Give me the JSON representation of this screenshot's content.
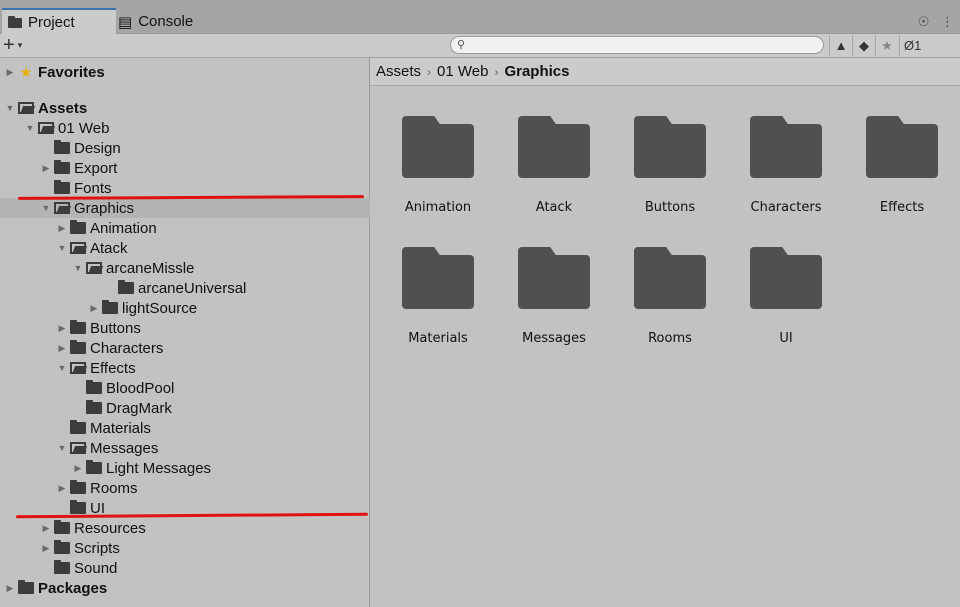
{
  "tabs": {
    "project": "Project",
    "console": "Console"
  },
  "tabbar_right": "☉ ⋮",
  "toolbar": {
    "plus": "+",
    "caret": "▾",
    "search_placeholder": "",
    "hidden_count": "1"
  },
  "tree": {
    "favorites": "Favorites",
    "assets": "Assets",
    "web": "01 Web",
    "design": "Design",
    "export": "Export",
    "fonts": "Fonts",
    "graphics": "Graphics",
    "animation": "Animation",
    "atack": "Atack",
    "arcaneMissle": "arcaneMissle",
    "arcaneUniversal": "arcaneUniversal",
    "lightSource": "lightSource",
    "buttons": "Buttons",
    "characters": "Characters",
    "effects": "Effects",
    "bloodPool": "BloodPool",
    "dragMark": "DragMark",
    "materials": "Materials",
    "messages": "Messages",
    "lightMessages": "Light Messages",
    "rooms": "Rooms",
    "ui": "UI",
    "resources": "Resources",
    "scripts": "Scripts",
    "sound": "Sound",
    "packages": "Packages"
  },
  "breadcrumb": {
    "assets": "Assets",
    "web": "01 Web",
    "graphics": "Graphics",
    "sep": "›"
  },
  "tiles": [
    "Animation",
    "Atack",
    "Buttons",
    "Characters",
    "Effects",
    "Materials",
    "Messages",
    "Rooms",
    "UI"
  ],
  "colors": {
    "annotation_red": "#e01010",
    "folder": "#505050",
    "tab_accent": "#3a72b0"
  }
}
